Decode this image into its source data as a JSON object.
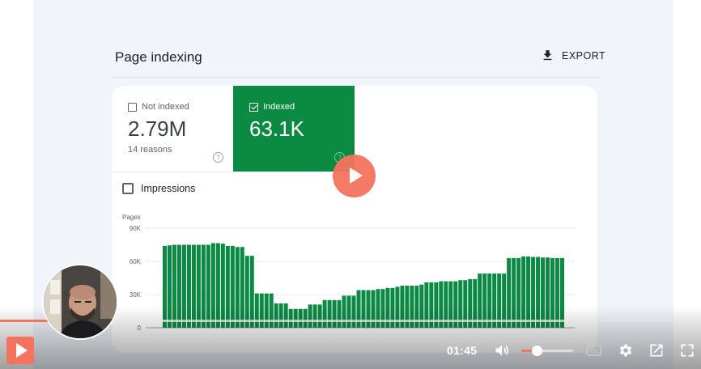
{
  "report": {
    "title": "Page indexing",
    "export_label": "EXPORT",
    "tiles": [
      {
        "label": "Not indexed",
        "value": "2.79M",
        "sub": "14 reasons",
        "selected": false
      },
      {
        "label": "Indexed",
        "value": "63.1K",
        "sub": "",
        "selected": true
      }
    ],
    "impressions_label": "Impressions",
    "help_glyph": "?"
  },
  "chart_data": {
    "type": "bar",
    "ylabel": "Pages",
    "ylim": [
      0,
      90000
    ],
    "yticks": [
      "90K",
      "60K",
      "30K",
      "0"
    ],
    "ytick_values": [
      90000,
      60000,
      30000,
      0
    ],
    "series": [
      {
        "color": "#0b8a43",
        "values": [
          74000,
          74500,
          75000,
          75000,
          75000,
          75000,
          75000,
          75000,
          75000,
          75000,
          76500,
          76500,
          76000,
          74000,
          74000,
          73000,
          73000,
          65000,
          65000,
          31000,
          31000,
          31000,
          31000,
          22000,
          22000,
          22000,
          17000,
          17000,
          17000,
          17000,
          21000,
          21000,
          21000,
          25000,
          25000,
          25000,
          25000,
          29000,
          29000,
          29000,
          34000,
          34000,
          34000,
          34000,
          35000,
          35000,
          36000,
          36000,
          37000,
          38000,
          38000,
          38000,
          38000,
          39000,
          41000,
          41000,
          41000,
          42000,
          42000,
          42000,
          42000,
          43000,
          43000,
          44000,
          44000,
          49000,
          49000,
          49000,
          49000,
          49000,
          49000,
          63000,
          63000,
          63000,
          64500,
          64500,
          64000,
          64000,
          63500,
          63500,
          63000,
          63000,
          63000
        ]
      }
    ],
    "grid": true
  },
  "player": {
    "time": "01:45",
    "progress": 0.095,
    "volume": 0.29,
    "accent": "#f4735e",
    "icons": [
      "play-icon",
      "volume-icon",
      "captions-icon",
      "settings-icon",
      "popout-icon",
      "fullscreen-icon"
    ]
  },
  "colors": {
    "indexed_green": "#0b8a43",
    "slide_bg": "#f1f4fb"
  }
}
